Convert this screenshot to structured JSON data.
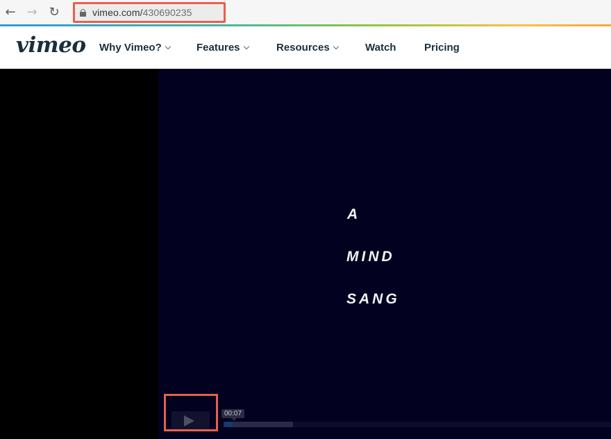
{
  "browser": {
    "back_icon": "arrow-left-icon",
    "forward_icon": "arrow-right-icon",
    "reload_icon": "reload-icon",
    "url_domain": "vimeo.com/",
    "url_path": "430690235"
  },
  "header": {
    "logo": "vimeo",
    "nav": [
      {
        "label": "Why Vimeo?",
        "dropdown": true
      },
      {
        "label": "Features",
        "dropdown": true
      },
      {
        "label": "Resources",
        "dropdown": true
      },
      {
        "label": "Watch",
        "dropdown": false
      },
      {
        "label": "Pricing",
        "dropdown": false
      }
    ]
  },
  "video": {
    "title_lines": [
      "A",
      "MIND",
      "SANG"
    ],
    "current_time": "00:07",
    "progress_played": 0.02,
    "progress_loaded": 0.18,
    "colors": {
      "frame_bg": "#020120",
      "highlight": "#e8604c"
    }
  }
}
